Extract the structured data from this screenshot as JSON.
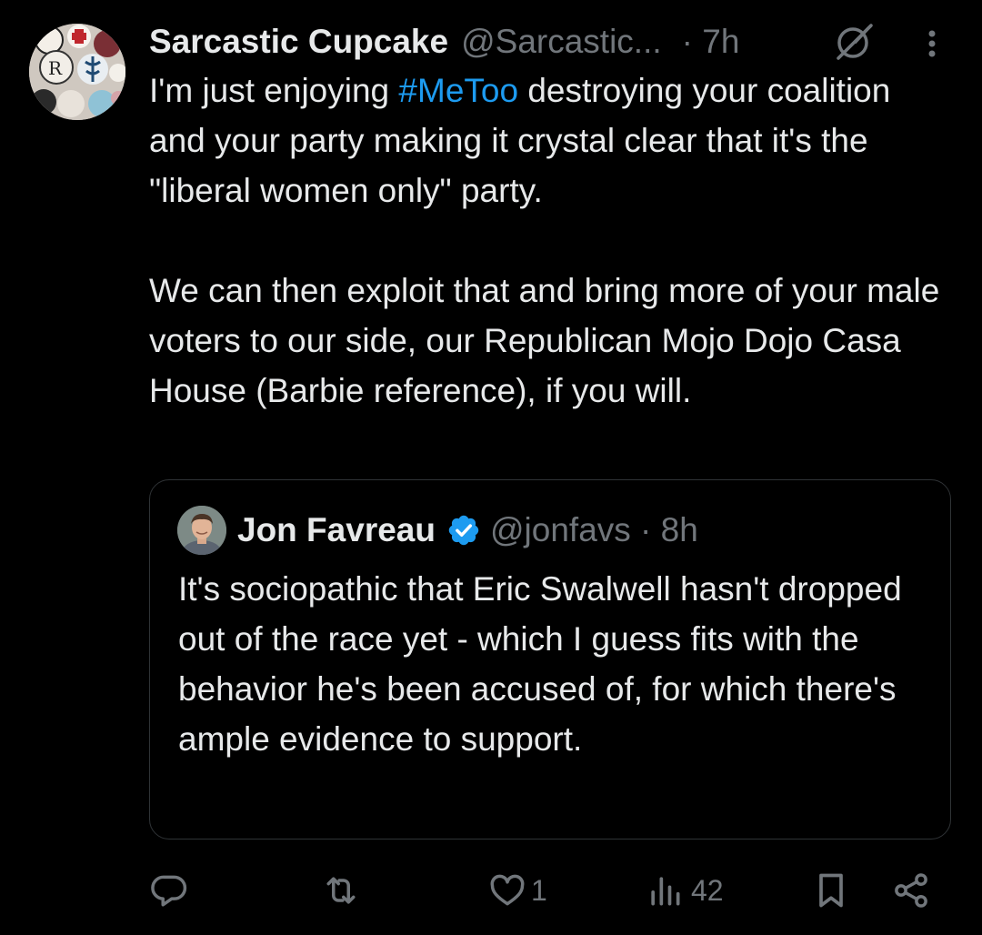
{
  "tweet": {
    "display_name": "Sarcastic Cupcake",
    "handle": "@Sarcastic...",
    "time": "· 7h",
    "text_before_hashtag": "I'm just enjoying ",
    "hashtag": "#MeToo",
    "text_after_hashtag": " destroying your coalition and your party making it crystal clear that it's the \"liberal women only\" party.\n\nWe can then exploit that and bring more of your male voters to our side, our Republican Mojo Dojo Casa House (Barbie reference), if you will."
  },
  "quote": {
    "display_name": "Jon Favreau",
    "handle": "@jonfavs · 8h",
    "text": "It's sociopathic that Eric Swalwell hasn't dropped out of the race yet - which I guess fits with the behavior he's been accused of, for which there's ample evidence to support."
  },
  "actions": {
    "reply_count": "",
    "repost_count": "",
    "like_count": "1",
    "views_count": "42"
  },
  "icons": {
    "header": [
      "grok-icon",
      "more-icon"
    ],
    "actions": [
      "reply-icon",
      "repost-icon",
      "like-icon",
      "views-icon",
      "bookmark-icon",
      "share-icon"
    ]
  },
  "colors": {
    "background": "#000000",
    "text": "#e7e9ea",
    "secondary": "#71767b",
    "accent": "#1d9bf0",
    "border": "#2f3336"
  }
}
